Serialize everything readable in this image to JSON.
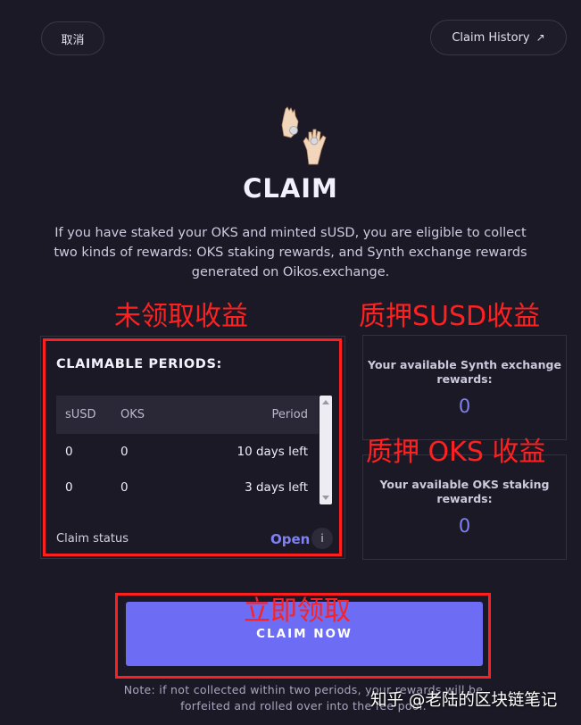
{
  "header": {
    "cancel_label": "取消",
    "history_label": "Claim History",
    "history_icon": "external-arrow-icon"
  },
  "hero": {
    "icon": "hands-exchanging-coin-icon",
    "title": "CLAIM",
    "description": "If you have staked your OKS and minted sUSD, you are eligible to collect two kinds of rewards: OKS staking rewards, and Synth exchange rewards generated on Oikos.exchange."
  },
  "annotations": {
    "unclaimed": "未领取收益",
    "susd_staking": "质押SUSD收益",
    "oks_staking": "质押 OKS 收益",
    "claim_now": "立即领取"
  },
  "periods": {
    "title": "CLAIMABLE PERIODS:",
    "columns": [
      "sUSD",
      "OKS",
      "Period"
    ],
    "rows": [
      {
        "susd": "0",
        "oks": "0",
        "period": "10 days left"
      },
      {
        "susd": "0",
        "oks": "0",
        "period": "3 days left"
      }
    ],
    "status_label": "Claim status",
    "status_value": "Open",
    "info_glyph": "i"
  },
  "rewards": {
    "synth_label": "Your available Synth exchange rewards:",
    "synth_value": "0",
    "oks_label": "Your available OKS staking rewards:",
    "oks_value": "0"
  },
  "claim_button_label": "CLAIM NOW",
  "note": "Note: if not collected within two periods, your rewards will be forfeited and rolled over into the fee pool.",
  "watermark": "知乎 @老陆的区块链笔记",
  "colors": {
    "background": "#1b1926",
    "accent": "#6c6cf5",
    "value": "#7e80f4",
    "annotation": "#ff1f1f"
  }
}
